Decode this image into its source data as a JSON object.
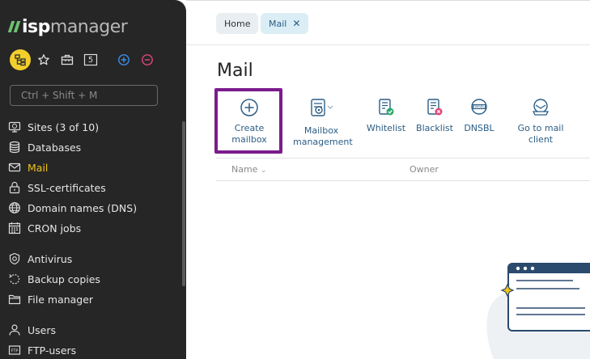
{
  "app": {
    "logo_bold": "isp",
    "logo_light": "manager"
  },
  "quickbar": {
    "counter": "5"
  },
  "search": {
    "placeholder": "Ctrl + Shift + M"
  },
  "sidebar": {
    "items": [
      {
        "label": "Sites (3 of 10)",
        "icon": "sites-icon"
      },
      {
        "label": "Databases",
        "icon": "database-icon"
      },
      {
        "label": "Mail",
        "icon": "mail-icon",
        "active": true
      },
      {
        "label": "SSL-certificates",
        "icon": "lock-icon"
      },
      {
        "label": "Domain names (DNS)",
        "icon": "globe-icon"
      },
      {
        "label": "CRON jobs",
        "icon": "calendar-icon"
      },
      {
        "label": "Antivirus",
        "icon": "shield-icon"
      },
      {
        "label": "Backup copies",
        "icon": "backup-icon"
      },
      {
        "label": "File manager",
        "icon": "folder-icon"
      },
      {
        "label": "Users",
        "icon": "user-icon"
      },
      {
        "label": "FTP-users",
        "icon": "ftp-icon"
      }
    ]
  },
  "tabs": [
    {
      "label": "Home"
    },
    {
      "label": "Mail",
      "active": true
    }
  ],
  "page": {
    "title": "Mail"
  },
  "toolbar": {
    "create_line1": "Create",
    "create_line2": "mailbox",
    "manage_line1": "Mailbox",
    "manage_line2": "management",
    "whitelist": "Whitelist",
    "blacklist": "Blacklist",
    "dnsbl": "DNSBL",
    "goto_line1": "Go to mail",
    "goto_line2": "client"
  },
  "table": {
    "columns": [
      "Name",
      "Owner"
    ]
  },
  "colors": {
    "sidebar_bg": "#262626",
    "accent": "#f0c419",
    "link": "#2a5d86",
    "highlight": "#7b1c8c"
  }
}
